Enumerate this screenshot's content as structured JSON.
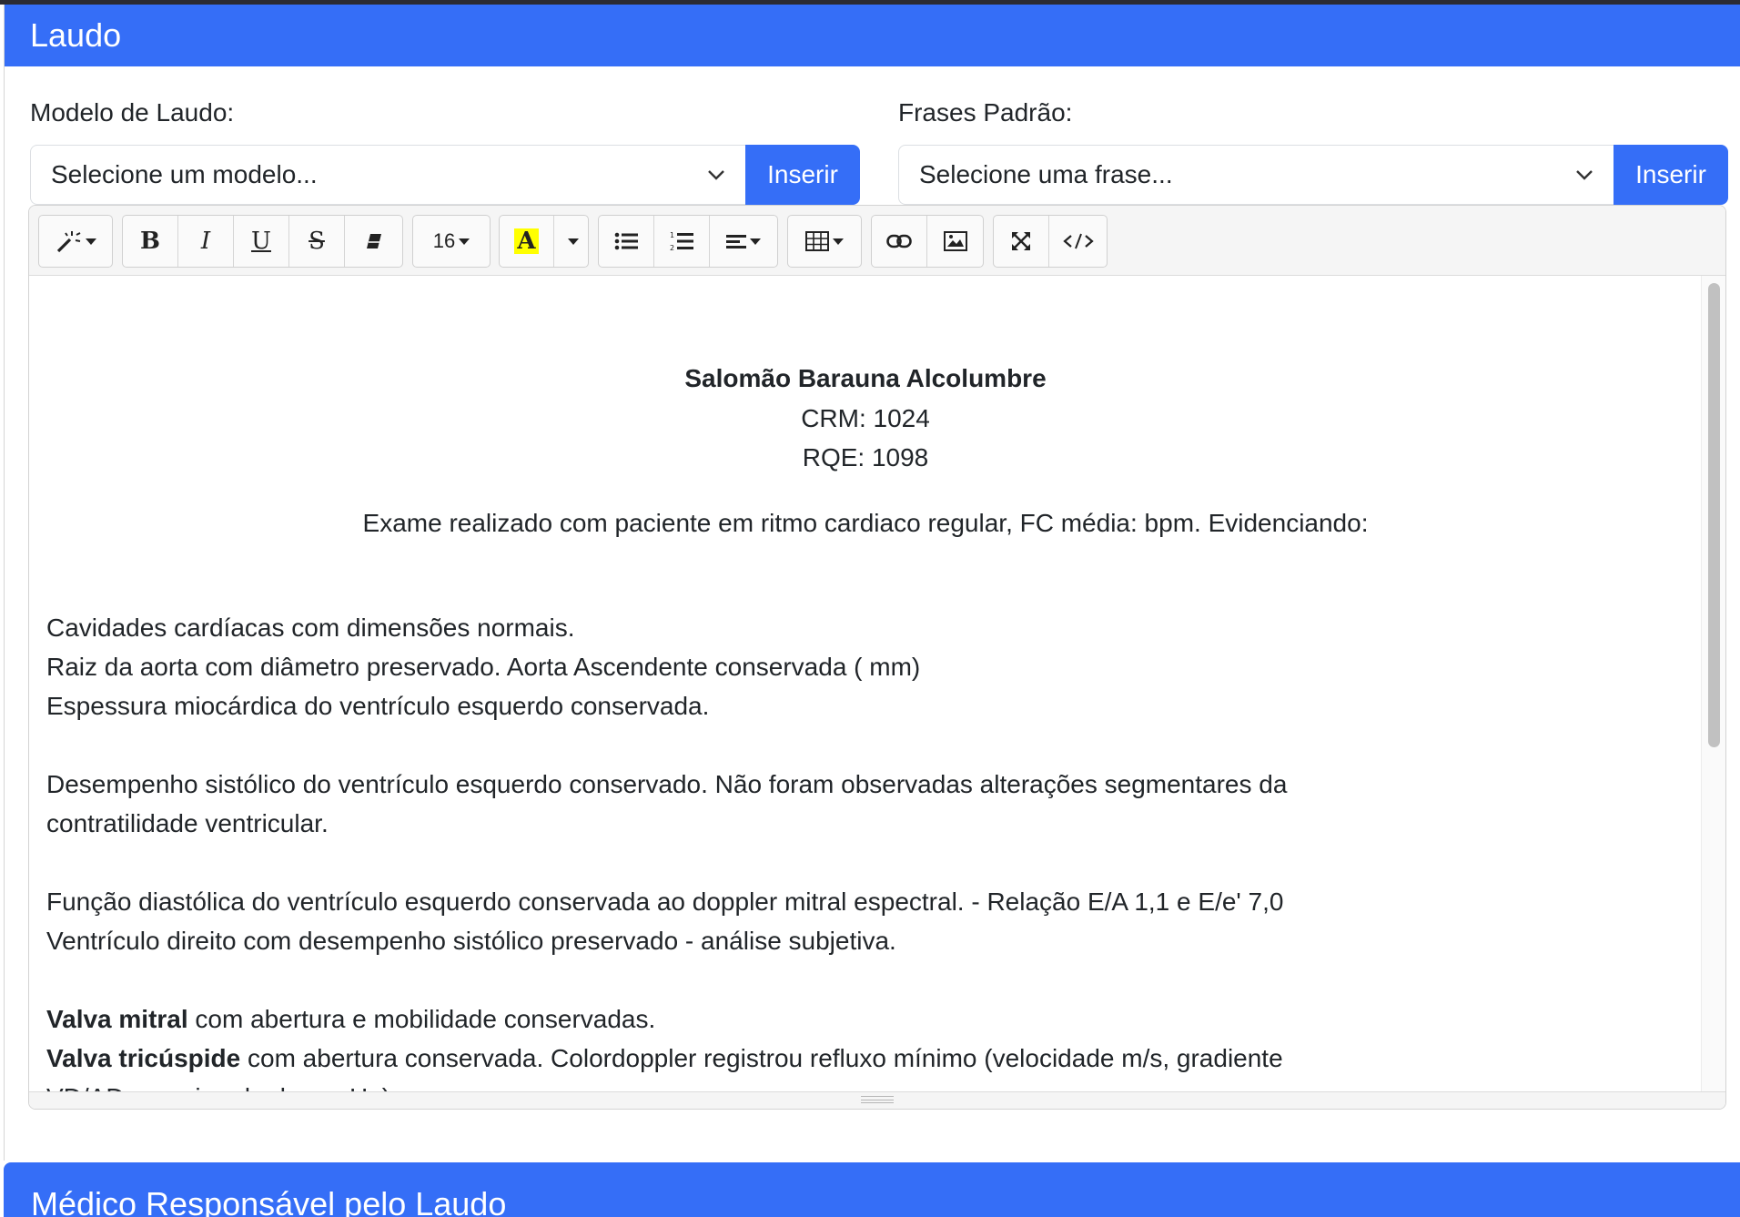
{
  "card": {
    "title": "Laudo"
  },
  "modelo": {
    "label": "Modelo de Laudo:",
    "select_value": "Selecione um modelo...",
    "insert_label": "Inserir"
  },
  "frases": {
    "label": "Frases Padrão:",
    "select_value": "Selecione uma frase...",
    "insert_label": "Inserir"
  },
  "toolbar": {
    "font_size": "16",
    "highlight_color": "#ffff00"
  },
  "doc": {
    "doctor_name": "Salomão Barauna Alcolumbre",
    "crm": "CRM: 1024",
    "rqe": "RQE: 1098",
    "intro": "Exame realizado com paciente em ritmo cardiaco regular, FC média: bpm. Evidenciando:",
    "line1": "Cavidades cardíacas com dimensões normais.",
    "line2": "Raiz da aorta com diâmetro preservado. Aorta Ascendente conservada ( mm)",
    "line3": "Espessura miocárdica do ventrículo esquerdo conservada.",
    "line4": "Desempenho sistólico do ventrículo esquerdo conservado. Não foram observadas alterações segmentares da",
    "line5": "contratilidade ventricular.",
    "line6": "Função diastólica do ventrículo esquerdo conservada ao doppler mitral espectral. - Relação E/A 1,1 e E/e' 7,0",
    "line7": "Ventrículo direito com desempenho sistólico preservado - análise subjetiva.",
    "mitral_bold": "Valva mitral",
    "mitral_rest": " com abertura e mobilidade conservadas.",
    "tricuspide_bold": "Valva tricúspide",
    "tricuspide_rest": " com abertura conservada. Colordoppler registrou refluxo mínimo (velocidade m/s, gradiente",
    "line_cut": "VD/AD aproximado de mmHg)"
  },
  "next_section": {
    "title": "Médico Responsável pelo Laudo"
  },
  "colors": {
    "primary": "#356ef7",
    "top_strip": "#2b2b33"
  }
}
